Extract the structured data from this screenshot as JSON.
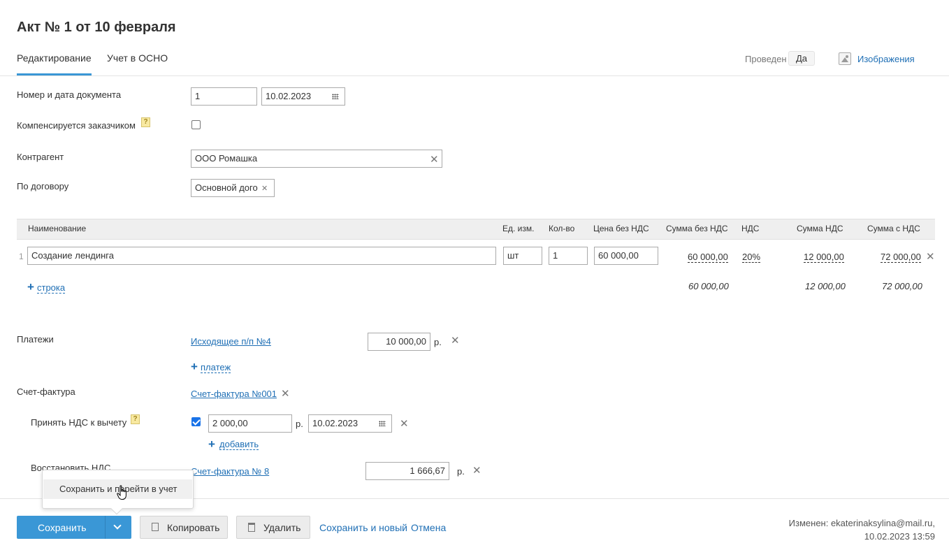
{
  "page_title": "Акт № 1 от 10 февраля",
  "tabs": [
    {
      "label": "Редактирование",
      "active": true
    },
    {
      "label": "Учет в ОСНО",
      "active": false
    }
  ],
  "header_right": {
    "provedeno_label": "Проведен",
    "provedeno_value": "Да",
    "images_link": "Изображения"
  },
  "form": {
    "doc_label": "Номер и дата документа",
    "doc_number": "1",
    "doc_date": "10.02.2023",
    "compensated_label": "Компенсируется заказчиком",
    "compensated_help": "?",
    "compensated_checked": false,
    "counterparty_label": "Контрагент",
    "counterparty_value": "ООО Ромашка",
    "contract_label": "По договору",
    "contract_value": "Основной дого"
  },
  "table": {
    "headers": {
      "name": "Наименование",
      "unit": "Ед. изм.",
      "qty": "Кол-во",
      "price": "Цена без НДС",
      "sum_no_vat": "Сумма без НДС",
      "vat": "НДС",
      "vat_sum": "Сумма НДС",
      "sum_with_vat": "Сумма с НДС"
    },
    "rows": [
      {
        "index": "1",
        "name": "Создание лендинга",
        "unit": "шт",
        "qty": "1",
        "price": "60 000,00",
        "sum_no_vat": "60 000,00",
        "vat": "20%",
        "vat_sum": "12 000,00",
        "sum_with_vat": "72 000,00"
      }
    ],
    "add_row_label": "строка",
    "totals": {
      "sum_no_vat": "60 000,00",
      "vat_sum": "12 000,00",
      "sum_with_vat": "72 000,00"
    }
  },
  "payments": {
    "label": "Платежи",
    "link": "Исходящее п/п №4",
    "amount": "10 000,00",
    "currency": "р.",
    "add_label": "платеж"
  },
  "invoice": {
    "label": "Счет-фактура",
    "link": "Счет-фактура №001",
    "vat_deduct_label": "Принять НДС к вычету",
    "vat_deduct_help": "?",
    "vat_deduct_checked": true,
    "vat_deduct_amount": "2 000,00",
    "vat_deduct_currency": "р.",
    "vat_deduct_date": "10.02.2023",
    "add_label": "добавить",
    "restore_label": "Восстановить НДС",
    "restore_link": "Счет-фактура № 8",
    "restore_amount": "1 666,67",
    "restore_currency": "р."
  },
  "footer": {
    "save_label": "Сохранить",
    "copy_label": "Копировать",
    "delete_label": "Удалить",
    "save_new_label": "Сохранить и новый",
    "cancel_label": "Отмена",
    "modified_label": "Изменен: ekaterinaksylina@mail.ru,",
    "modified_date": "10.02.2023 13:59",
    "dropdown_item": "Сохранить и перейти в учет"
  },
  "colors": {
    "accent": "#3a97d6",
    "link": "#1f6fb5"
  }
}
